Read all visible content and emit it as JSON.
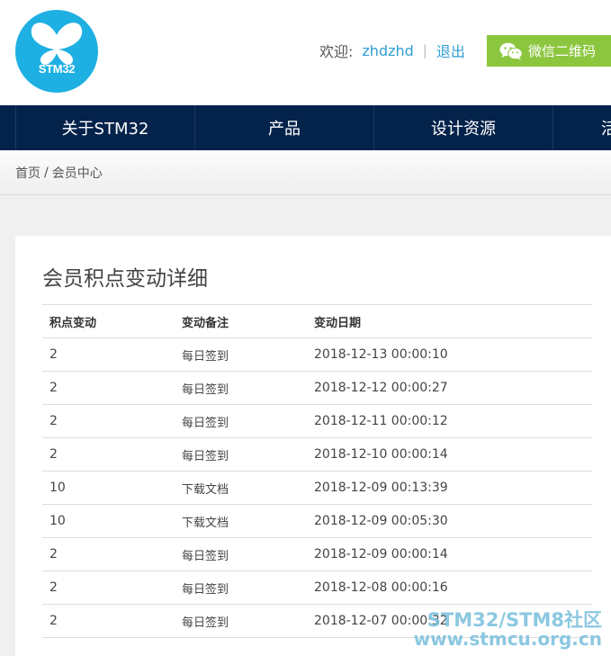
{
  "brand": {
    "logo_text": "STM32",
    "color": "#1fb0e3"
  },
  "user": {
    "welcome_label": "欢迎:",
    "username": "zhdzhd",
    "separator": "|",
    "logout_label": "退出",
    "wechat_qr_label": "微信二维码"
  },
  "nav": {
    "items": [
      {
        "label": "关于STM32"
      },
      {
        "label": "产品"
      },
      {
        "label": "设计资源"
      },
      {
        "label": "活"
      }
    ]
  },
  "breadcrumb": {
    "home": "首页",
    "separator": "/",
    "current": "会员中心"
  },
  "points": {
    "title": "会员积点变动详细",
    "columns": [
      "积点变动",
      "变动备注",
      "变动日期"
    ],
    "rows": [
      [
        "2",
        "每日签到",
        "2018-12-13 00:00:10"
      ],
      [
        "2",
        "每日签到",
        "2018-12-12 00:00:27"
      ],
      [
        "2",
        "每日签到",
        "2018-12-11 00:00:12"
      ],
      [
        "2",
        "每日签到",
        "2018-12-10 00:00:14"
      ],
      [
        "10",
        "下载文档",
        "2018-12-09 00:13:39"
      ],
      [
        "10",
        "下载文档",
        "2018-12-09 00:05:30"
      ],
      [
        "2",
        "每日签到",
        "2018-12-09 00:00:14"
      ],
      [
        "2",
        "每日签到",
        "2018-12-08 00:00:16"
      ],
      [
        "2",
        "每日签到",
        "2018-12-07 00:00:32"
      ]
    ]
  },
  "watermark": {
    "line1": "STM32/STM8社区",
    "line2": "www.stmcu.org.cn"
  },
  "colors": {
    "nav_bg": "#03234b",
    "link": "#2f9fd1",
    "wechat_button": "#8cc63e"
  }
}
